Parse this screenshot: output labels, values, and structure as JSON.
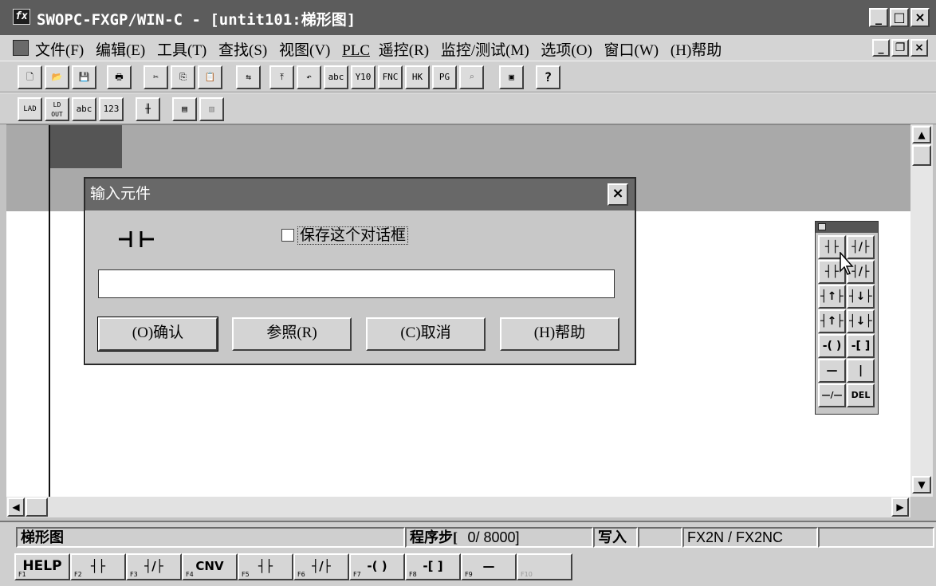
{
  "window": {
    "title": "SWOPC-FXGP/WIN-C - [untit101:梯形图]",
    "controls": [
      "_",
      "□",
      "×"
    ]
  },
  "menubar": {
    "items": [
      "文件(F)",
      "编辑(E)",
      "工具(T)",
      "查找(S)",
      "视图(V)",
      "PLC",
      "遥控(R)",
      "监控/测试(M)",
      "选项(O)",
      "窗口(W)",
      "(H)帮助"
    ],
    "doc_controls": [
      "_",
      "❐",
      "×"
    ]
  },
  "toolbar1": {
    "buttons": [
      {
        "name": "new-file-icon",
        "glyph": "🗋"
      },
      {
        "name": "open-folder-icon",
        "glyph": "📂"
      },
      {
        "name": "save-disk-icon",
        "glyph": "💾"
      },
      {
        "name": "print-icon",
        "glyph": "🖶"
      },
      {
        "name": "cut-icon",
        "glyph": "✂"
      },
      {
        "name": "copy-icon",
        "glyph": "⎘"
      },
      {
        "name": "paste-icon",
        "glyph": "📋"
      },
      {
        "name": "transfer-icon",
        "glyph": "⇆"
      },
      {
        "name": "page-top-icon",
        "glyph": "⤒"
      },
      {
        "name": "page-back-icon",
        "glyph": "↶"
      },
      {
        "name": "comment-abc-icon",
        "glyph": "abc"
      },
      {
        "name": "coil-y10-icon",
        "glyph": "Y10"
      },
      {
        "name": "fnc-icon",
        "glyph": "FNC"
      },
      {
        "name": "monitor-hk-icon",
        "glyph": "HK"
      },
      {
        "name": "pg-icon",
        "glyph": "PG"
      },
      {
        "name": "binoculars-icon",
        "glyph": "⌕"
      },
      {
        "name": "window-switch-icon",
        "glyph": "▣"
      },
      {
        "name": "help-question-icon",
        "glyph": "?"
      }
    ]
  },
  "toolbar2": {
    "buttons": [
      {
        "name": "ladder-view-icon",
        "glyph": "LAD"
      },
      {
        "name": "instruction-list-icon",
        "glyph": "LD OUT"
      },
      {
        "name": "comment-mode-icon",
        "glyph": "abc"
      },
      {
        "name": "numeric-123-icon",
        "glyph": "123"
      },
      {
        "name": "contact-grid-icon",
        "glyph": "╫"
      },
      {
        "name": "monitor-on-icon",
        "glyph": "▤"
      },
      {
        "name": "monitor-off-icon",
        "glyph": "▥"
      }
    ]
  },
  "dialog": {
    "title": "输入元件",
    "close": "×",
    "contact_symbol": "contact-no-icon",
    "checkbox_label": "保存这个对话框",
    "checkbox_checked": false,
    "input_value": "",
    "buttons": {
      "ok": "(O)确认",
      "ref": "参照(R)",
      "cancel": "(C)取消",
      "help": "(H)帮助"
    }
  },
  "palette": {
    "buttons": [
      {
        "name": "contact-no-icon",
        "glyph": "┤├"
      },
      {
        "name": "contact-nc-icon",
        "glyph": "┤/├"
      },
      {
        "name": "parallel-no-icon",
        "glyph": "┤├"
      },
      {
        "name": "parallel-nc-icon",
        "glyph": "┤/├"
      },
      {
        "name": "pulse-rise-icon",
        "glyph": "┤↑├"
      },
      {
        "name": "pulse-fall-icon",
        "glyph": "┤↓├"
      },
      {
        "name": "parallel-rise-icon",
        "glyph": "┤↑├"
      },
      {
        "name": "parallel-fall-icon",
        "glyph": "┤↓├"
      },
      {
        "name": "coil-icon",
        "glyph": "-( )"
      },
      {
        "name": "function-icon",
        "glyph": "-[ ]"
      },
      {
        "name": "horizontal-line-icon",
        "glyph": "—"
      },
      {
        "name": "vertical-line-icon",
        "glyph": "|"
      },
      {
        "name": "invert-icon",
        "glyph": "—/—"
      },
      {
        "name": "delete-icon",
        "glyph": "DEL"
      }
    ]
  },
  "statusbar": {
    "view": "梯形图",
    "step_label": "程序步[",
    "step_value": "0/ 8000]",
    "mode": "写入",
    "plc_model": "FX2N / FX2NC"
  },
  "fkeys": [
    {
      "num": "F1",
      "label": "HELP"
    },
    {
      "num": "F2",
      "label": "┤├"
    },
    {
      "num": "F3",
      "label": "┤/├"
    },
    {
      "num": "F4",
      "label": "CNV"
    },
    {
      "num": "F5",
      "label": "┤├"
    },
    {
      "num": "F6",
      "label": "┤/├"
    },
    {
      "num": "F7",
      "label": "-( )"
    },
    {
      "num": "F8",
      "label": "-[ ]"
    },
    {
      "num": "F9",
      "label": "—"
    },
    {
      "num": "F10",
      "label": ""
    }
  ]
}
